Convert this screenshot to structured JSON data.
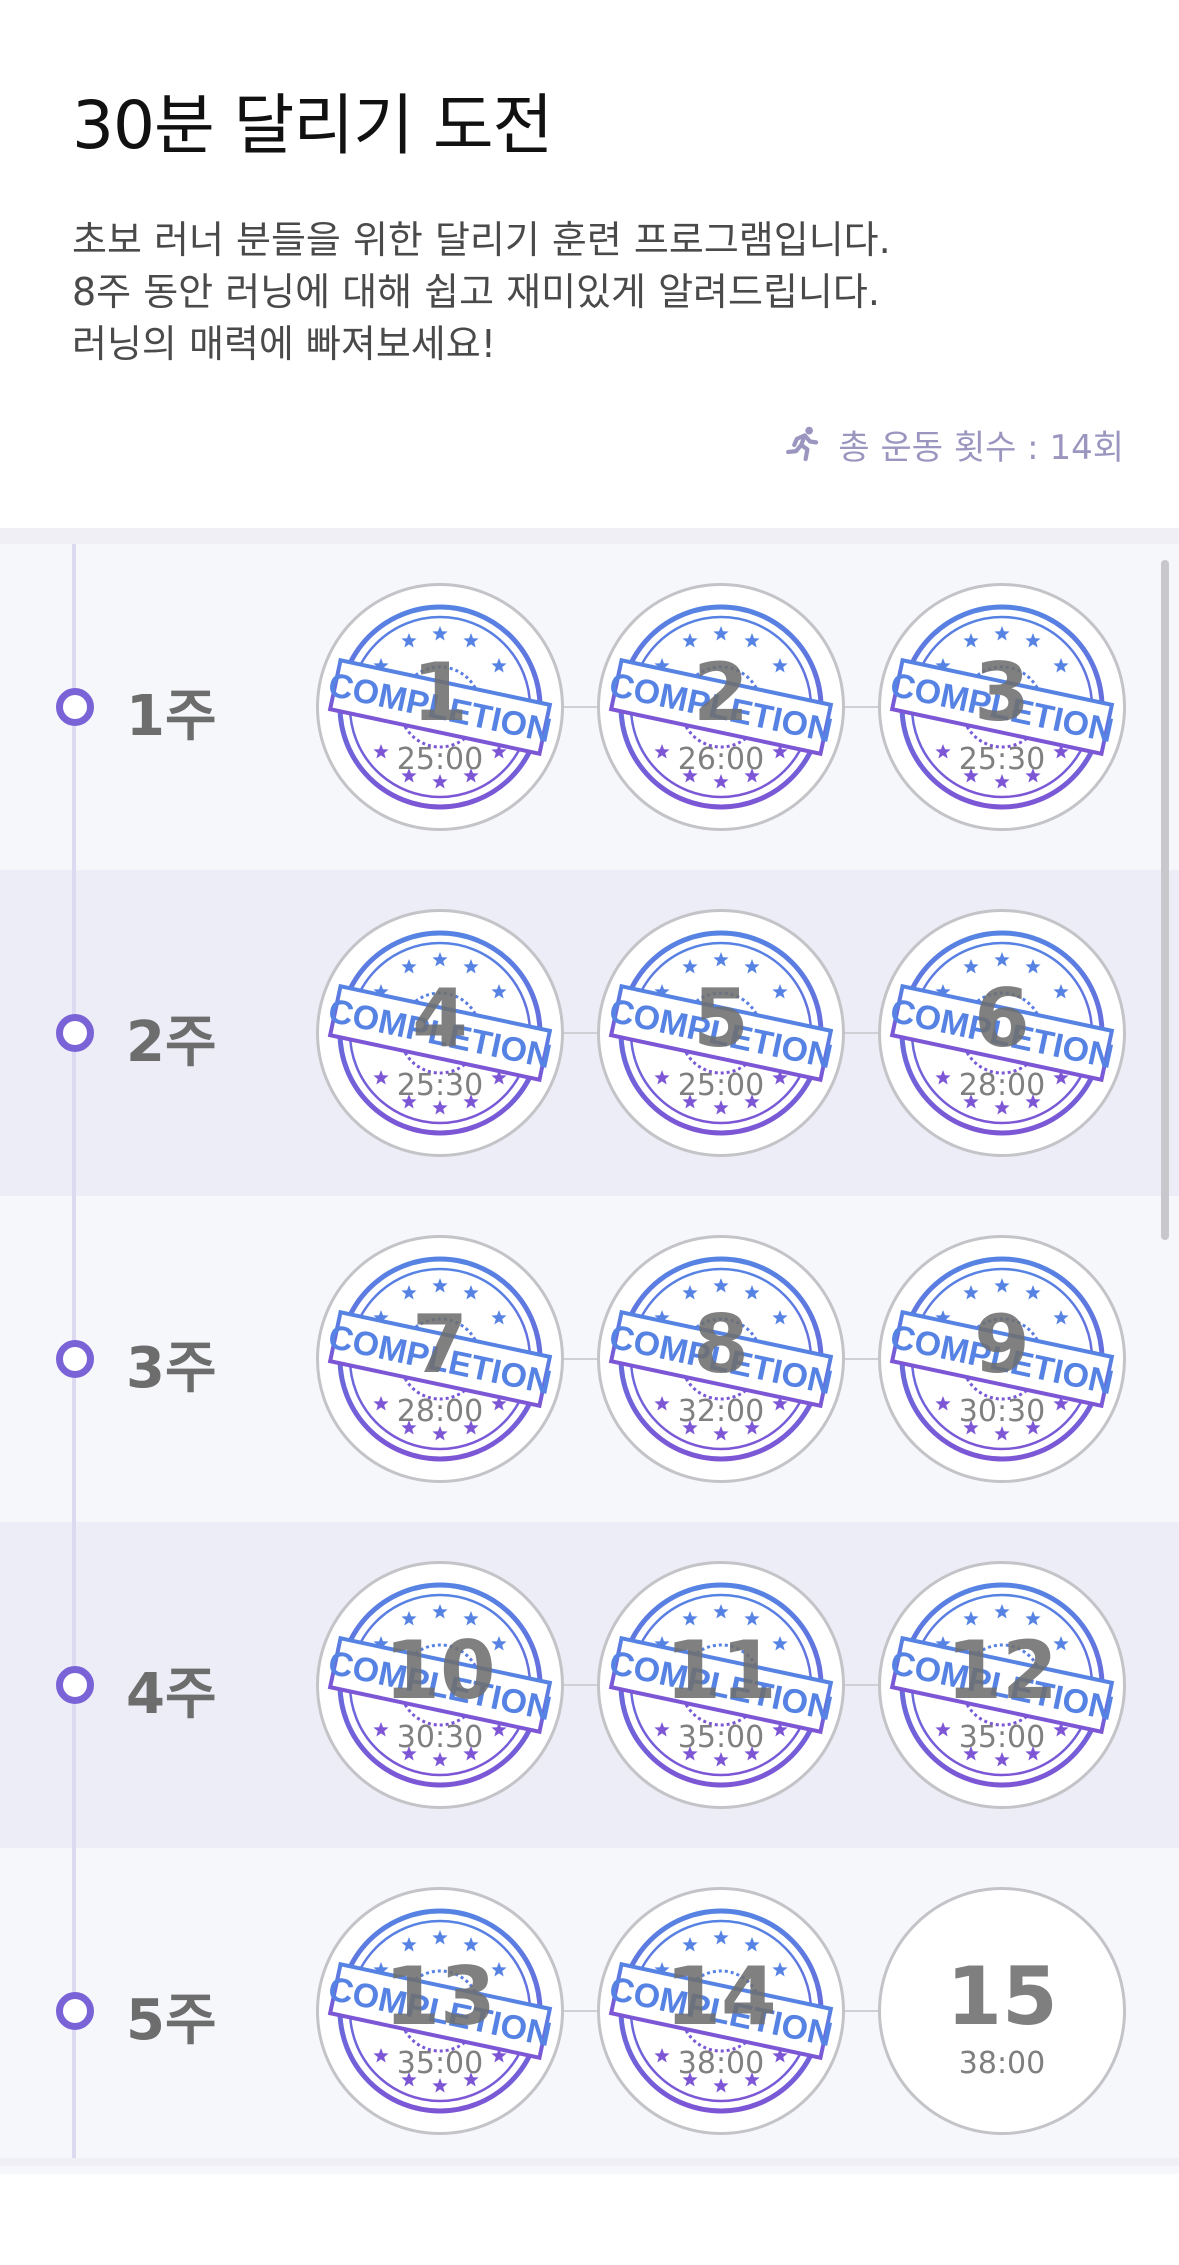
{
  "header": {
    "title": "30분 달리기 도전",
    "description": [
      "초보 러너 분들을 위한 달리기 훈련 프로그램입니다.",
      "8주 동안 러닝에 대해 쉽고 재미있게 알려드립니다.",
      "러닝의 매력에 빠져보세요!"
    ],
    "total_label": "총 운동 횟수 : 14회",
    "total_icon": "running-person-icon"
  },
  "colors": {
    "accent": "#7a63d6",
    "stamp_blue": "#3f73e0",
    "stamp_purple": "#6a3fd0",
    "row_light": "#f6f7fb",
    "row_dark": "#ecedf6"
  },
  "stamp_text": "COMPLETION",
  "weeks": [
    {
      "label": "1주",
      "sessions": [
        {
          "number": "1",
          "time": "25:00",
          "completed": true
        },
        {
          "number": "2",
          "time": "26:00",
          "completed": true
        },
        {
          "number": "3",
          "time": "25:30",
          "completed": true
        }
      ]
    },
    {
      "label": "2주",
      "sessions": [
        {
          "number": "4",
          "time": "25:30",
          "completed": true
        },
        {
          "number": "5",
          "time": "25:00",
          "completed": true
        },
        {
          "number": "6",
          "time": "28:00",
          "completed": true
        }
      ]
    },
    {
      "label": "3주",
      "sessions": [
        {
          "number": "7",
          "time": "28:00",
          "completed": true
        },
        {
          "number": "8",
          "time": "32:00",
          "completed": true
        },
        {
          "number": "9",
          "time": "30:30",
          "completed": true
        }
      ]
    },
    {
      "label": "4주",
      "sessions": [
        {
          "number": "10",
          "time": "30:30",
          "completed": true
        },
        {
          "number": "11",
          "time": "35:00",
          "completed": true
        },
        {
          "number": "12",
          "time": "35:00",
          "completed": true
        }
      ]
    },
    {
      "label": "5주",
      "sessions": [
        {
          "number": "13",
          "time": "35:00",
          "completed": true
        },
        {
          "number": "14",
          "time": "38:00",
          "completed": true
        },
        {
          "number": "15",
          "time": "38:00",
          "completed": false
        }
      ]
    }
  ]
}
